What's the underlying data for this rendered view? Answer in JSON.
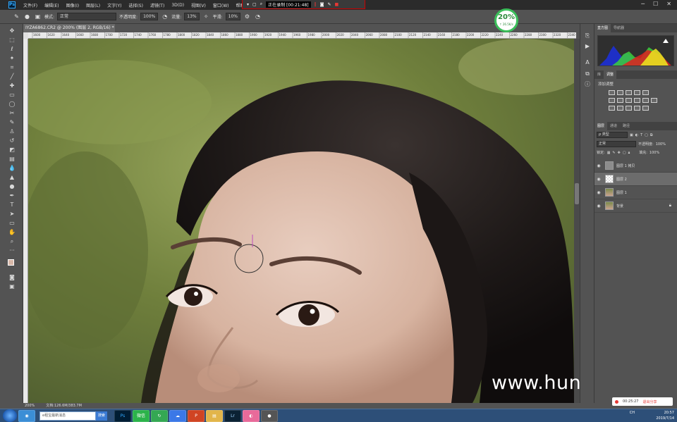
{
  "menubar": {
    "items": [
      "文件(F)",
      "编辑(E)",
      "图像(I)",
      "图层(L)",
      "文字(Y)",
      "选择(S)",
      "滤镜(T)",
      "3D(D)",
      "视图(V)",
      "窗口(W)",
      "帮助(H)"
    ]
  },
  "recording": {
    "status": "正在录制 [00:21:48]"
  },
  "options": {
    "mode_label": "模式:",
    "mode_value": "正常",
    "opacity_label": "不透明度:",
    "opacity_value": "100%",
    "flow_label": "流量:",
    "flow_value": "13%",
    "smooth_label": "平滑:",
    "smooth_value": "10%"
  },
  "percent_badge": {
    "big": "20%",
    "small": "↑ 26.5K/s"
  },
  "document": {
    "tab_title": "IYZA6862.CR2 @ 200% (图层 2, RGB/16) *",
    "ruler_ticks": [
      "1600",
      "1620",
      "1640",
      "1660",
      "1680",
      "1700",
      "1720",
      "1740",
      "1760",
      "1780",
      "1800",
      "1820",
      "1840",
      "1860",
      "1880",
      "1900",
      "1920",
      "1940",
      "1960",
      "1980",
      "2000",
      "2020",
      "2040",
      "2060",
      "2080",
      "2100",
      "2120",
      "2140",
      "2160",
      "2180",
      "2200",
      "2220",
      "2240",
      "2260",
      "2280",
      "2300",
      "2320",
      "2340"
    ],
    "zoom": "200%",
    "file_info": "文档:126.6M/383.7M"
  },
  "panels": {
    "top_tabs": [
      "直方图",
      "导航器"
    ],
    "adj_tabs": [
      "库",
      "调整"
    ],
    "adj_title": "添加调整",
    "layer_tabs": [
      "图层",
      "通道",
      "路径"
    ],
    "kind_label": "ρ 类型",
    "blend_mode": "正常",
    "opacity_label": "不透明度:",
    "opacity_value": "100%",
    "lock_label": "锁定:",
    "fill_label": "填充:",
    "fill_value": "100%",
    "layers": [
      {
        "name": "图层 1 拷贝",
        "selected": false
      },
      {
        "name": "图层 2",
        "selected": true
      },
      {
        "name": "图层 1",
        "selected": false
      },
      {
        "name": "背景",
        "selected": false
      }
    ]
  },
  "recording_pill": {
    "time": "00:25:27",
    "exit": "退出分享"
  },
  "watermark": "www.hunls.com",
  "taskbar": {
    "search_placeholder": "e租宝最新消息",
    "search_button": "搜索",
    "apps": [
      "Ps",
      "微信",
      "↻",
      "☁",
      "P",
      "▤",
      "Lr",
      "◐",
      "●"
    ],
    "tray_time": "20:57",
    "tray_date": "2019/7/14",
    "tray_lang": "CH"
  }
}
